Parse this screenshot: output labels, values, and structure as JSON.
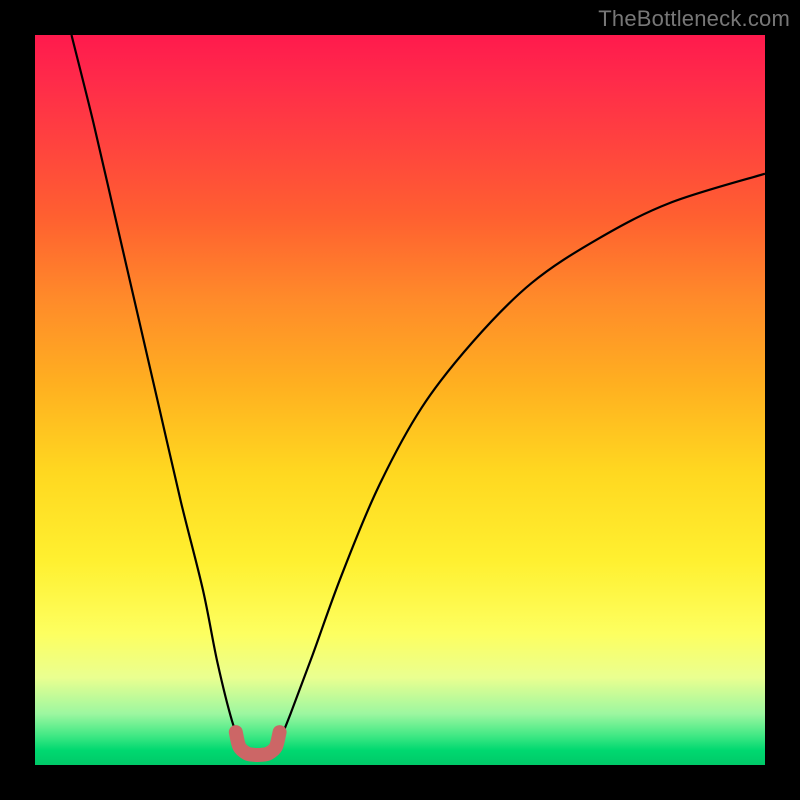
{
  "watermark": "TheBottleneck.com",
  "colors": {
    "background": "#000000",
    "curve": "#000000",
    "marker": "#cc6666",
    "gradient_top": "#ff1a4d",
    "gradient_bottom": "#00c968"
  },
  "chart_data": {
    "type": "line",
    "title": "",
    "xlabel": "",
    "ylabel": "",
    "xlim": [
      0,
      100
    ],
    "ylim": [
      0,
      100
    ],
    "grid": false,
    "legend": false,
    "annotations": [
      "TheBottleneck.com"
    ],
    "series": [
      {
        "name": "bottleneck_curve_left",
        "x": [
          5,
          8,
          11,
          14,
          17,
          20,
          23,
          25,
          27,
          28.5
        ],
        "y": [
          100,
          88,
          75,
          62,
          49,
          36,
          24,
          14,
          6,
          2
        ]
      },
      {
        "name": "bottleneck_curve_right",
        "x": [
          33,
          35,
          38,
          42,
          47,
          53,
          60,
          68,
          77,
          87,
          100
        ],
        "y": [
          2,
          7,
          15,
          26,
          38,
          49,
          58,
          66,
          72,
          77,
          81
        ]
      },
      {
        "name": "optimal_zone_marker",
        "x": [
          27.5,
          28,
          29,
          30,
          31,
          32,
          33,
          33.5
        ],
        "y": [
          4.5,
          2.5,
          1.6,
          1.4,
          1.4,
          1.6,
          2.5,
          4.5
        ]
      }
    ]
  }
}
